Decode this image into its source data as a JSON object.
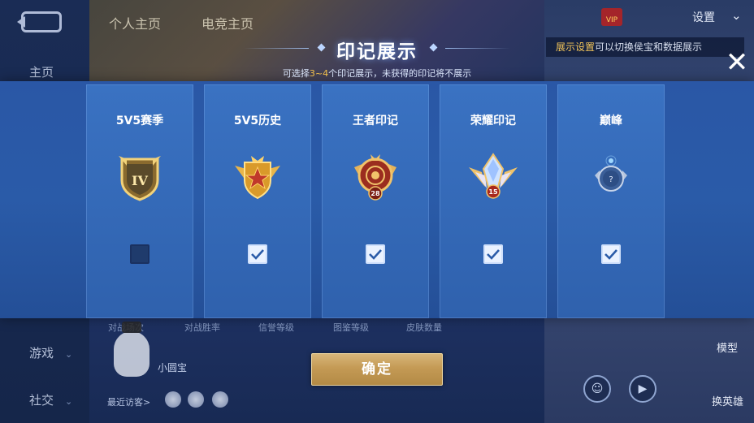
{
  "background": {
    "nav": {
      "home": "主页",
      "game": "游戏",
      "social": "社交"
    },
    "tabs": [
      "个人主页",
      "电竞主页"
    ],
    "settings": "设置",
    "vip": "VIP",
    "hint": {
      "highlight": "展示设置",
      "text": "可以切换侯宝和数据展示"
    },
    "stats": [
      "对战场次",
      "对战胜率",
      "信誉等级",
      "图鉴等级",
      "皮肤数量"
    ],
    "mascot_name": "小圆宝",
    "recent_visitors": "最近访客>",
    "model_label": "模型",
    "swap_hero_label": "换英雄"
  },
  "modal": {
    "title": "印记展示",
    "subtitle_prefix": "可选择",
    "subtitle_range": "3~4",
    "subtitle_suffix": "个印记展示，未获得的印记将不展示",
    "cards": [
      {
        "label": "5V5赛季",
        "checked": false,
        "emblem": "season-iv-emblem",
        "emblem_text": "IV"
      },
      {
        "label": "5V5历史",
        "checked": true,
        "emblem": "star-winged-emblem",
        "emblem_text": ""
      },
      {
        "label": "王者印记",
        "checked": true,
        "emblem": "king-emblem",
        "emblem_text": "28"
      },
      {
        "label": "荣耀印记",
        "checked": true,
        "emblem": "glory-crystal-emblem",
        "emblem_text": "15"
      },
      {
        "label": "巅峰",
        "checked": true,
        "emblem": "peak-emblem",
        "emblem_text": "?"
      }
    ],
    "confirm": "确定"
  },
  "colors": {
    "modal_bg": "#2a5ba8",
    "card_bg": "#3469b7",
    "accent_gold": "#c49a55",
    "highlight_yellow": "#f3c04b"
  }
}
